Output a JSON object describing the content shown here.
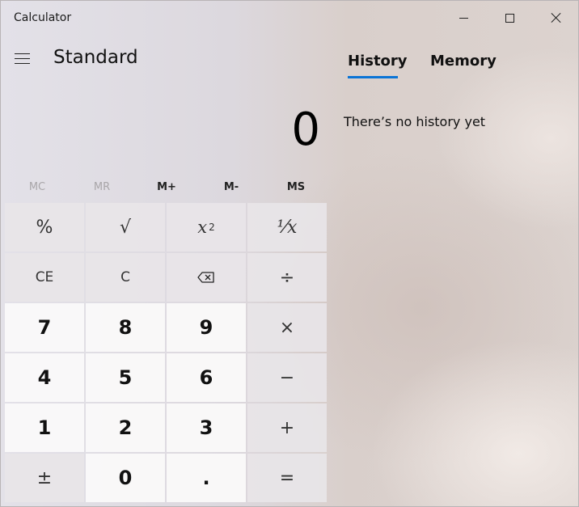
{
  "window": {
    "title": "Calculator"
  },
  "header": {
    "mode": "Standard"
  },
  "display": {
    "value": "0"
  },
  "memory_row": [
    {
      "label": "MC",
      "enabled": false
    },
    {
      "label": "MR",
      "enabled": false
    },
    {
      "label": "M+",
      "enabled": true
    },
    {
      "label": "M-",
      "enabled": true
    },
    {
      "label": "MS",
      "enabled": true
    }
  ],
  "keys": {
    "percent": "%",
    "sqrt": "√",
    "square_base": "x",
    "square_exp": "2",
    "reciprocal": "¹⁄x",
    "ce": "CE",
    "c": "C",
    "divide": "÷",
    "seven": "7",
    "eight": "8",
    "nine": "9",
    "multiply": "×",
    "four": "4",
    "five": "5",
    "six": "6",
    "minus": "−",
    "one": "1",
    "two": "2",
    "three": "3",
    "plus": "+",
    "negate": "±",
    "zero": "0",
    "decimal": ".",
    "equals": "="
  },
  "panel": {
    "tabs": [
      "History",
      "Memory"
    ],
    "active_tab": "History",
    "empty_message": "There’s no history yet"
  },
  "colors": {
    "accent": "#0a74d6"
  }
}
